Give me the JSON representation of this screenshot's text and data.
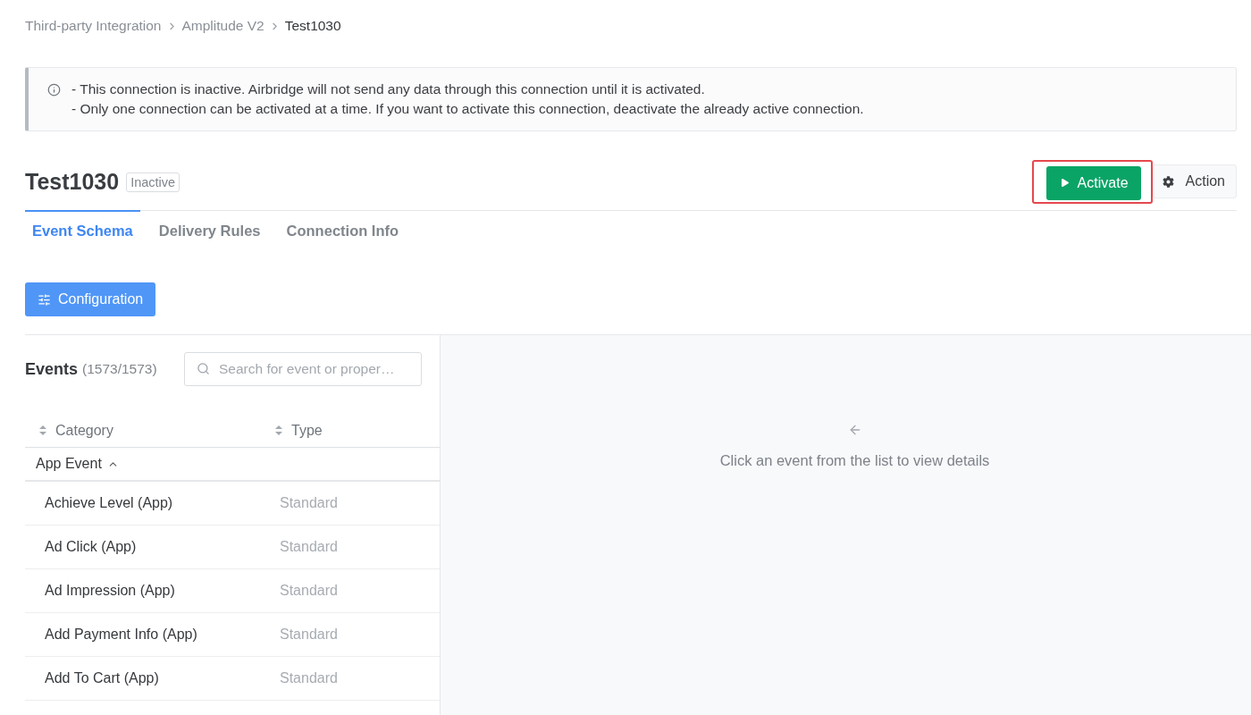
{
  "breadcrumb": [
    {
      "label": "Third-party Integration",
      "current": false
    },
    {
      "label": "Amplitude V2",
      "current": false
    },
    {
      "label": "Test1030",
      "current": true
    }
  ],
  "alert": {
    "lines": [
      "- This connection is inactive. Airbridge will not send any data through this connection until it is activated.",
      "- Only one connection can be activated at a time. If you want to activate this connection, deactivate the already active connection."
    ]
  },
  "header": {
    "title": "Test1030",
    "status": "Inactive",
    "actions": [
      {
        "label": "Activate",
        "kind": "primary",
        "highlighted": true
      },
      {
        "label": "Action",
        "kind": "secondary",
        "highlighted": false
      }
    ]
  },
  "tabs": [
    {
      "label": "Event Schema",
      "selected": true
    },
    {
      "label": "Delivery Rules",
      "selected": false
    },
    {
      "label": "Connection Info",
      "selected": false
    }
  ],
  "configuration_button": {
    "label": "Configuration"
  },
  "events_panel": {
    "title": "Events",
    "count": "(1573/1573)",
    "search": {
      "placeholder": "Search for event or proper…"
    },
    "table": {
      "columns": [
        "Category",
        "Type"
      ],
      "groups": [
        {
          "label": "App Event",
          "expanded": true,
          "rows": [
            {
              "name": "Achieve Level (App)",
              "type": "Standard"
            },
            {
              "name": "Ad Click (App)",
              "type": "Standard"
            },
            {
              "name": "Ad Impression (App)",
              "type": "Standard"
            },
            {
              "name": "Add Payment Info (App)",
              "type": "Standard"
            },
            {
              "name": "Add To Cart (App)",
              "type": "Standard"
            }
          ]
        }
      ]
    }
  },
  "detail_panel": {
    "message": "Click an event from the list to view details"
  }
}
